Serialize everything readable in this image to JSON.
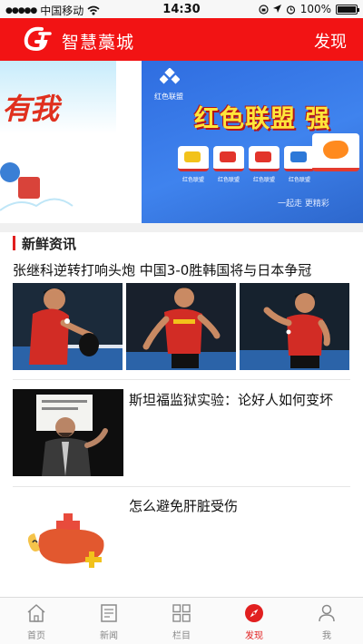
{
  "status_bar": {
    "carrier": "中国移动",
    "time": "14:30",
    "battery": "100%"
  },
  "header": {
    "app_title": "智慧藁城",
    "discover_label": "发现"
  },
  "banner": {
    "left_text": "有我",
    "main_logo_text": "红色联盟",
    "main_title": "红色联盟 强",
    "tile_labels": [
      "红色联盟",
      "红色联盟",
      "红色联盟",
      "红色联盟"
    ],
    "slogan": "一起走 更精彩"
  },
  "news": {
    "section_title": "新鲜资讯",
    "headline": "张继科逆转打响头炮 中国3-0胜韩国将与日本争冠",
    "articles": [
      {
        "title": "斯坦福监狱实验：论好人如何变坏"
      },
      {
        "title": "怎么避免肝脏受伤"
      }
    ]
  },
  "tab_bar": {
    "items": [
      {
        "label": "首页",
        "icon": "home-icon"
      },
      {
        "label": "新闻",
        "icon": "news-icon"
      },
      {
        "label": "栏目",
        "icon": "grid-icon"
      },
      {
        "label": "发现",
        "icon": "compass-icon",
        "active": true
      },
      {
        "label": "我",
        "icon": "user-icon"
      }
    ]
  },
  "colors": {
    "brand_red": "#f21314",
    "active_tab": "#e11f1f",
    "inactive_tab": "#888888"
  }
}
